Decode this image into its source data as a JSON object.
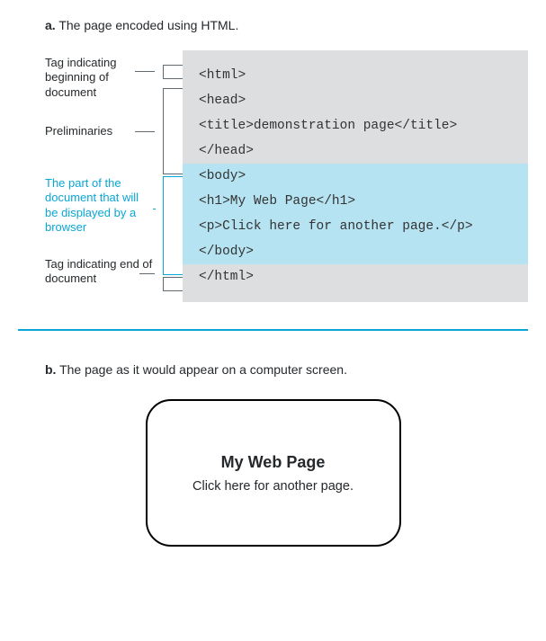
{
  "a": {
    "letter": "a.",
    "caption": "The page encoded using HTML.",
    "labels": {
      "tag_begin": "Tag indicating beginning of document",
      "prelim": "Preliminaries",
      "body": "The part of the document that will be displayed by a browser",
      "tag_end": "Tag indicating end of document"
    },
    "code": {
      "html_open": "<html>",
      "head_open": "<head>",
      "title": "<title>demonstration page</title>",
      "head_close": "</head>",
      "body_open": "<body>",
      "h1": "<h1>My Web Page</h1>",
      "p": "<p>Click here for another page.</p>",
      "body_close": "</body>",
      "html_close": "</html>"
    }
  },
  "b": {
    "letter": "b.",
    "caption": "The page as it would appear on a computer screen.",
    "heading": "My Web Page",
    "para": "Click here for another page."
  }
}
